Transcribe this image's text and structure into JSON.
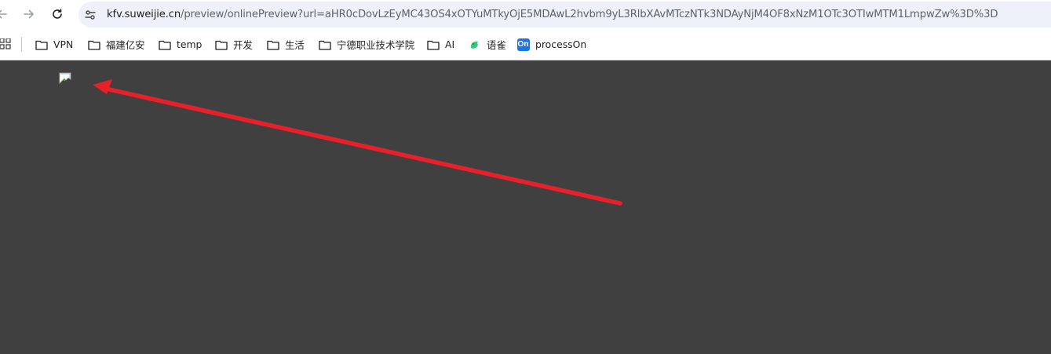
{
  "browser": {
    "address_bar": {
      "host": "kfv.suweijie.cn",
      "path": "/preview/onlinePreview?url=aHR0cDovLzEyMC43OS4xOTYuMTkyOjE5MDAwL2hvbm9yL3RlbXAvMTczNTk3NDAyNjM4OF8xNzM1OTc3OTIwMTM1LmpwZw%3D%3D"
    }
  },
  "bookmarks": [
    {
      "label": "VPN",
      "icon": "folder-icon"
    },
    {
      "label": "福建亿安",
      "icon": "folder-icon"
    },
    {
      "label": "temp",
      "icon": "folder-icon"
    },
    {
      "label": "开发",
      "icon": "folder-icon"
    },
    {
      "label": "生活",
      "icon": "folder-icon"
    },
    {
      "label": "宁德职业技术学院",
      "icon": "folder-icon"
    },
    {
      "label": "AI",
      "icon": "folder-icon"
    },
    {
      "label": "语雀",
      "icon": "yuque-icon"
    },
    {
      "label": "processOn",
      "icon": "processon-icon",
      "badge": "On"
    }
  ],
  "colors": {
    "content_background": "#404040",
    "annotation_arrow": "#e8202a",
    "toolbar_background": "#ffffff"
  }
}
